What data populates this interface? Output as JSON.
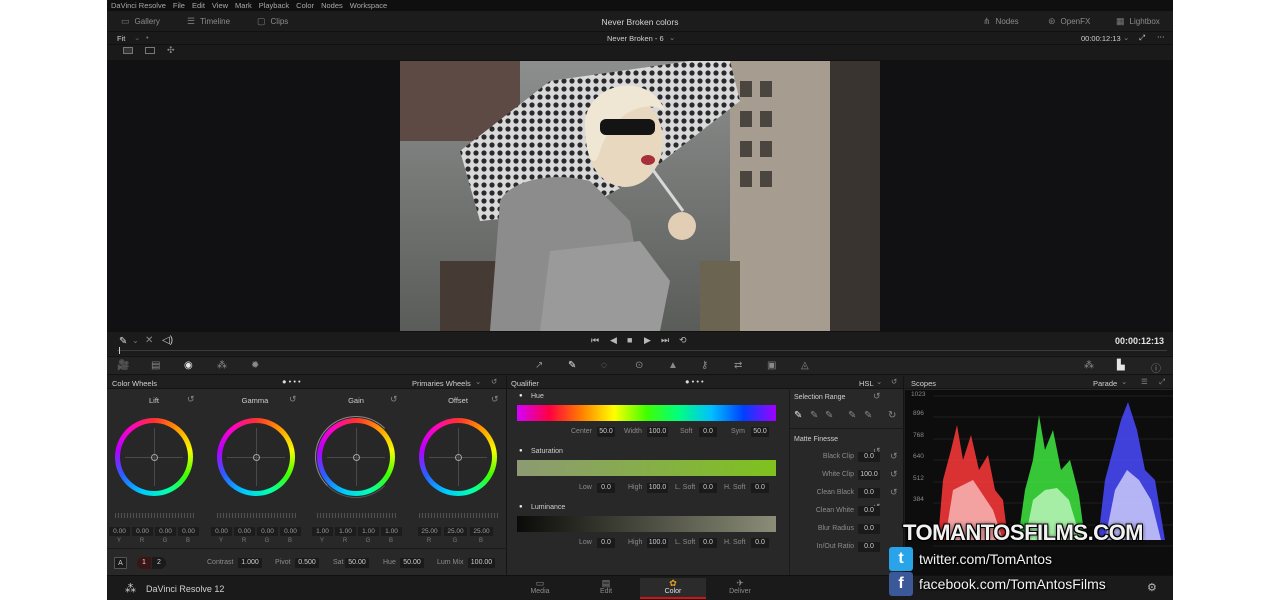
{
  "menubar": [
    "DaVinci Resolve",
    "File",
    "Edit",
    "View",
    "Mark",
    "Playback",
    "Color",
    "Nodes",
    "Workspace"
  ],
  "topbar": {
    "left": [
      {
        "icon": "gallery-icon",
        "label": "Gallery"
      },
      {
        "icon": "timeline-icon",
        "label": "Timeline"
      },
      {
        "icon": "clips-icon",
        "label": "Clips"
      }
    ],
    "title": "Never Broken colors",
    "right": [
      {
        "icon": "nodes-icon",
        "label": "Nodes"
      },
      {
        "icon": "openfx-icon",
        "label": "OpenFX"
      },
      {
        "icon": "lightbox-icon",
        "label": "Lightbox"
      }
    ]
  },
  "viewer_bar": {
    "fit": "Fit",
    "clip_name": "Never Broken - 6",
    "timecode": "00:00:12:13"
  },
  "transport": {
    "timecode": "00:00:12:13"
  },
  "color_wheels": {
    "title": "Color Wheels",
    "mode": "Primaries Wheels",
    "wheels": [
      {
        "name": "Lift",
        "values": [
          "0.00",
          "0.00",
          "0.00",
          "0.00"
        ],
        "channels": [
          "Y",
          "R",
          "G",
          "B"
        ]
      },
      {
        "name": "Gamma",
        "values": [
          "0.00",
          "0.00",
          "0.00",
          "0.00"
        ],
        "channels": [
          "Y",
          "R",
          "G",
          "B"
        ]
      },
      {
        "name": "Gain",
        "values": [
          "1.00",
          "1.00",
          "1.00",
          "1.00"
        ],
        "channels": [
          "Y",
          "R",
          "G",
          "B"
        ]
      },
      {
        "name": "Offset",
        "values": [
          "25.00",
          "25.00",
          "25.00"
        ],
        "channels": [
          "R",
          "G",
          "B"
        ]
      }
    ],
    "footer": {
      "a_button": "A",
      "page1": "1",
      "page2": "2",
      "contrast_label": "Contrast",
      "contrast": "1.000",
      "pivot_label": "Pivot",
      "pivot": "0.500",
      "sat_label": "Sat",
      "sat": "50.00",
      "hue_label": "Hue",
      "hue": "50.00",
      "lummix_label": "Lum Mix",
      "lummix": "100.00"
    }
  },
  "qualifier": {
    "title": "Qualifier",
    "mode": "HSL",
    "hue": {
      "label": "Hue",
      "center_label": "Center",
      "center": "50.0",
      "width_label": "Width",
      "width": "100.0",
      "soft_label": "Soft",
      "soft": "0.0",
      "sym_label": "Sym",
      "sym": "50.0"
    },
    "saturation": {
      "label": "Saturation",
      "low_label": "Low",
      "low": "0.0",
      "high_label": "High",
      "high": "100.0",
      "lsoft_label": "L. Soft",
      "lsoft": "0.0",
      "hsoft_label": "H. Soft",
      "hsoft": "0.0"
    },
    "luminance": {
      "label": "Luminance",
      "low_label": "Low",
      "low": "0.0",
      "high_label": "High",
      "high": "100.0",
      "lsoft_label": "L. Soft",
      "lsoft": "0.0",
      "hsoft_label": "H. Soft",
      "hsoft": "0.0"
    },
    "selection_range": "Selection Range",
    "matte_finesse": "Matte Finesse",
    "finesse": [
      {
        "label": "Black Clip",
        "value": "0.0"
      },
      {
        "label": "White Clip",
        "value": "100.0"
      },
      {
        "label": "Clean Black",
        "value": "0.0"
      },
      {
        "label": "Clean White",
        "value": "0.0"
      },
      {
        "label": "Blur Radius",
        "value": "0.0"
      },
      {
        "label": "In/Out Ratio",
        "value": "0.0"
      }
    ]
  },
  "scopes": {
    "title": "Scopes",
    "mode": "Parade",
    "ticks": [
      "1023",
      "896",
      "768",
      "640",
      "512",
      "384"
    ]
  },
  "pages": [
    {
      "icon": "media-icon",
      "label": "Media"
    },
    {
      "icon": "edit-icon",
      "label": "Edit"
    },
    {
      "icon": "color-icon",
      "label": "Color"
    },
    {
      "icon": "deliver-icon",
      "label": "Deliver"
    }
  ],
  "app_name": "DaVinci Resolve 12",
  "watermark": {
    "brand": "TOMANTOSFILMS.COM",
    "twitter": "twitter.com/TomAntos",
    "facebook": "facebook.com/TomAntosFilms"
  },
  "colors": {
    "accent": "#d01414",
    "panel": "#282829",
    "bg": "#1e1e1f"
  }
}
